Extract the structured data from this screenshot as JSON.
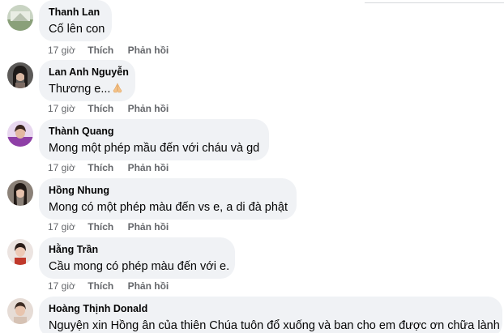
{
  "comments": [
    {
      "author": "Thanh Lan",
      "text": "Cố lên con",
      "time": "17 giờ",
      "like_label": "Thích",
      "reply_label": "Phản hồi"
    },
    {
      "author": "Lan Anh Nguyễn",
      "text": "Thương e...",
      "time": "17 giờ",
      "like_label": "Thích",
      "reply_label": "Phản hồi",
      "emoji": "folded-hands-emoji"
    },
    {
      "author": "Thành Quang",
      "text": "Mong một phép mầu đến với cháu và gd",
      "time": "17 giờ",
      "like_label": "Thích",
      "reply_label": "Phản hồi"
    },
    {
      "author": "Hồng Nhung",
      "text": "Mong có một phép màu đến vs e, a di đà phật",
      "time": "17 giờ",
      "like_label": "Thích",
      "reply_label": "Phản hồi"
    },
    {
      "author": "Hằng Trần",
      "text": "Cầu mong có phép màu đến với e.",
      "time": "17 giờ",
      "like_label": "Thích",
      "reply_label": "Phản hồi"
    },
    {
      "author": "Hoàng Thịnh Donald",
      "text": "Nguyện xin Hồng ân của thiên Chúa tuôn đổ xuống và ban cho em được ơn chữa lành"
    }
  ],
  "colors": {
    "bubble": "#f0f2f5",
    "text": "#050505",
    "meta": "#65676b"
  }
}
